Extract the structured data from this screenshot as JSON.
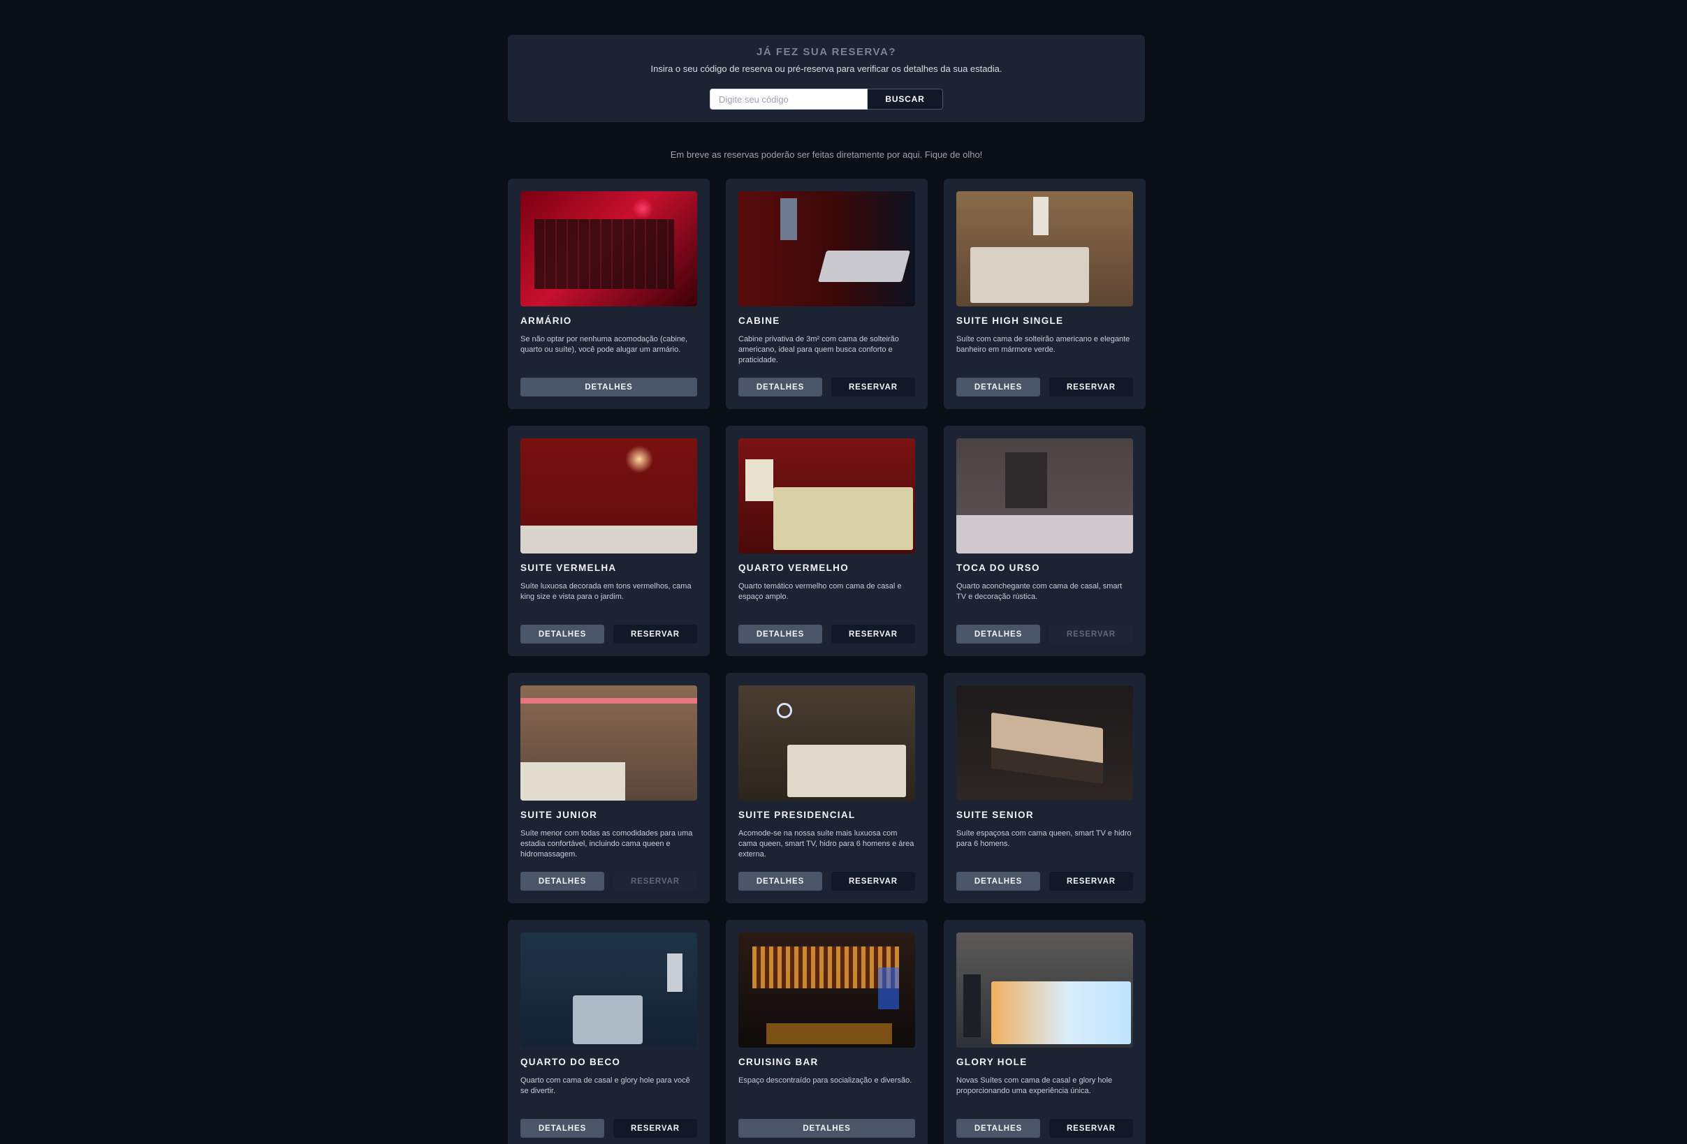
{
  "lookup": {
    "title": "JÁ FEZ SUA RESERVA?",
    "subtitle": "Insira o seu código de reserva ou pré-reserva para verificar os detalhes da sua estadia.",
    "placeholder": "Digite seu código",
    "button_label": "BUSCAR"
  },
  "notice": "Em breve as reservas poderão ser feitas diretamente por aqui. Fique de olho!",
  "buttons": {
    "details": "DETALHES",
    "reserve": "RESERVAR"
  },
  "rooms": [
    {
      "name": "ARMÁRIO",
      "description": "Se não optar por nenhuma acomodação (cabine, quarto ou suíte), você pode alugar um armário.",
      "reserve": "none"
    },
    {
      "name": "CABINE",
      "description": "Cabine privativa de 3m² com cama de solteirão americano, ideal para quem busca conforto e praticidade.",
      "reserve": "enabled"
    },
    {
      "name": "SUITE HIGH SINGLE",
      "description": "Suíte com cama de solteirão americano e elegante banheiro em mármore verde.",
      "reserve": "enabled"
    },
    {
      "name": "SUITE VERMELHA",
      "description": "Suíte luxuosa decorada em tons vermelhos, cama king size e vista para o jardim.",
      "reserve": "enabled"
    },
    {
      "name": "QUARTO VERMELHO",
      "description": "Quarto temático vermelho com cama de casal e espaço amplo.",
      "reserve": "enabled"
    },
    {
      "name": "TOCA DO URSO",
      "description": "Quarto aconchegante com cama de casal, smart TV e decoração rústica.",
      "reserve": "disabled"
    },
    {
      "name": "SUITE JUNIOR",
      "description": "Suíte menor com todas as comodidades para uma estadia confortável, incluindo cama queen e hidromassagem.",
      "reserve": "disabled"
    },
    {
      "name": "SUITE PRESIDENCIAL",
      "description": "Acomode-se na nossa suíte mais luxuosa com cama queen, smart TV, hidro para 6 homens e área externa.",
      "reserve": "enabled"
    },
    {
      "name": "SUITE SENIOR",
      "description": "Suíte espaçosa com cama queen, smart TV e hidro para 6 homens.",
      "reserve": "enabled"
    },
    {
      "name": "QUARTO DO BECO",
      "description": "Quarto com cama de casal e glory hole para você se divertir.",
      "reserve": "enabled"
    },
    {
      "name": "CRUISING BAR",
      "description": "Espaço descontraído para socialização e diversão.",
      "reserve": "none"
    },
    {
      "name": "GLORY HOLE",
      "description": "Novas Suítes com cama de casal e glory hole proporcionando uma experiência única.",
      "reserve": "enabled"
    }
  ]
}
